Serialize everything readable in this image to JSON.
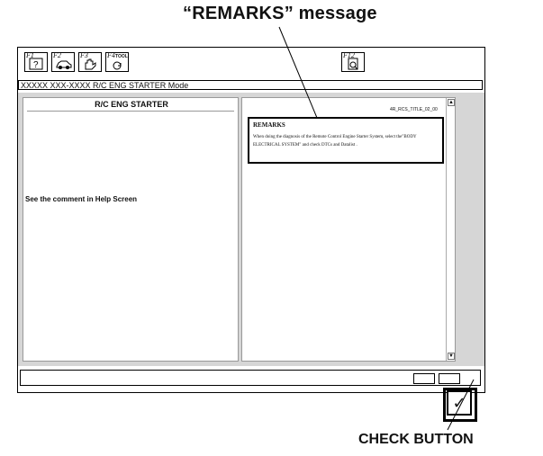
{
  "callouts": {
    "remarks_label": "“REMARKS” message",
    "check_label": "CHECK BUTTON"
  },
  "toolbar": {
    "left_keys": [
      "F1",
      "F2",
      "F3",
      "F4"
    ],
    "f4_tool": "TOOL",
    "right_key": "F12"
  },
  "status": {
    "text": "XXXXX XXX-XXXX R/C ENG STARTER Mode"
  },
  "left_panel": {
    "title": "R/C ENG STARTER",
    "comment": "See the comment in Help Screen"
  },
  "right_panel": {
    "ref_code": "4R_RCS_TITLE_02_00",
    "remarks_title": "REMARKS",
    "remarks_text": "When doing the diagnosis of the Remote Control Engine Starter System, select the\"BODY ELECTRICAL SYSTEM\" and check DTCs and Datalist ."
  },
  "check_button": {
    "glyph": "✓"
  }
}
